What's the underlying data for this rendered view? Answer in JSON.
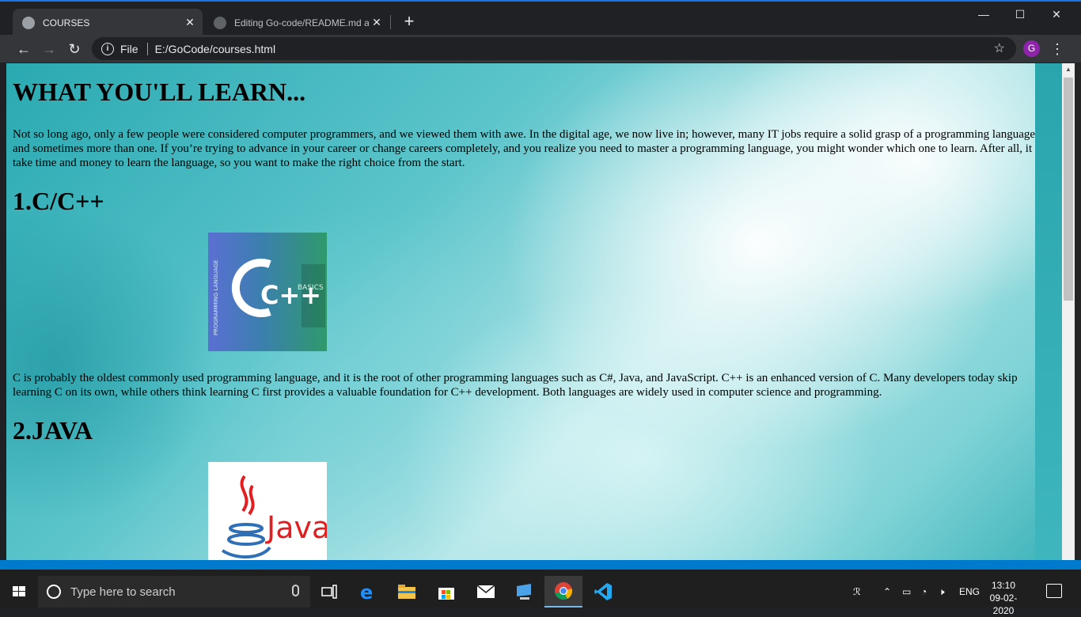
{
  "browser": {
    "tabs": [
      {
        "title": "COURSES",
        "active": true
      },
      {
        "title": "Editing Go-code/README.md at",
        "active": false
      }
    ],
    "address": {
      "scheme": "File",
      "url": "E:/GoCode/courses.html"
    },
    "profile_initial": "G"
  },
  "page": {
    "title": "WHAT YOU'LL LEARN...",
    "intro": "Not so long ago, only a few people were considered computer programmers, and we viewed them with awe. In the digital age, we now live in; however, many IT jobs require a solid grasp of a programming language, and sometimes more than one. If you’re trying to advance in your career or change careers completely, and you realize you need to master a programming language, you might wonder which one to learn. After all, it will take time and money to learn the language, so you want to make the right choice from the start.",
    "sections": [
      {
        "heading": "1.C/C++",
        "image_text": "C++",
        "image_side_text": "BASICS",
        "description": "C is probably the oldest commonly used programming language, and it is the root of other programming languages such as C#, Java, and JavaScript. C++ is an enhanced version of C. Many developers today skip learning C on its own, while others think learning C first provides a valuable foundation for C++ development. Both languages are widely used in computer science and programming."
      },
      {
        "heading": "2.JAVA",
        "image_text": "Java"
      }
    ]
  },
  "taskbar": {
    "search_placeholder": "Type here to search",
    "language": "ENG",
    "time": "13:10",
    "date": "09-02-2020"
  },
  "colors": {
    "chrome_dark": "#202124",
    "chrome_toolbar": "#35363a",
    "vscode_status": "#007acc",
    "taskbar": "#1f1f1f"
  }
}
